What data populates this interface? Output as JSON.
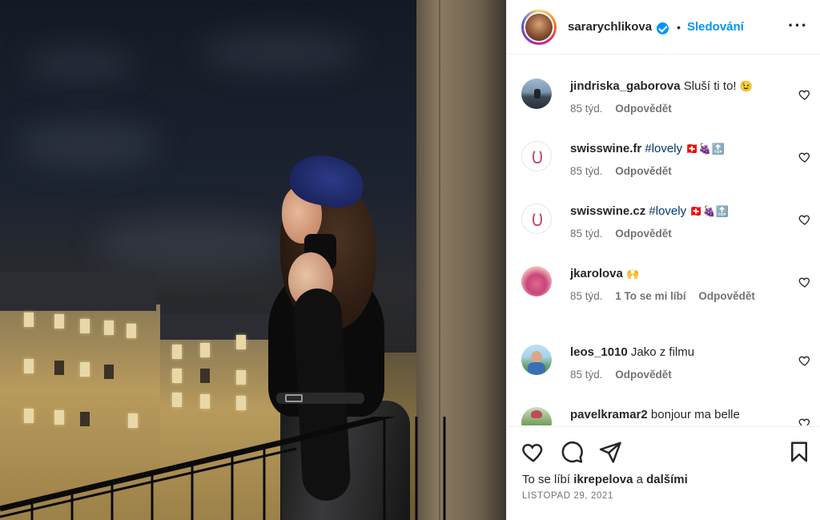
{
  "post": {
    "author": "sararychlikova",
    "follow_label": "Sledování",
    "dot": "•",
    "more": "•••"
  },
  "comments": [
    {
      "user": "jindriska_gaborova",
      "text": "Sluší ti to!",
      "emoji": "😉",
      "tag": "",
      "flags": "",
      "age": "85 týd.",
      "likes": "",
      "reply": "Odpovědět",
      "avatar": "landscape"
    },
    {
      "user": "swisswine.fr",
      "text": "",
      "emoji": "",
      "tag": "#lovely",
      "flags": "🇨🇭🍇🔝",
      "age": "85 týd.",
      "likes": "",
      "reply": "Odpovědět",
      "avatar": "swisswine"
    },
    {
      "user": "swisswine.cz",
      "text": "",
      "emoji": "",
      "tag": "#lovely",
      "flags": "🇨🇭🍇🔝",
      "age": "85 týd.",
      "likes": "",
      "reply": "Odpovědět",
      "avatar": "swisswine"
    },
    {
      "user": "jkarolova",
      "text": "",
      "emoji": "🙌",
      "tag": "",
      "flags": "",
      "age": "85 týd.",
      "likes": "1 To se mi líbí",
      "reply": "Odpovědět",
      "avatar": "pink"
    },
    {
      "user": "leos_1010",
      "text": "Jako z filmu",
      "emoji": "",
      "tag": "",
      "flags": "",
      "age": "85 týd.",
      "likes": "",
      "reply": "Odpovědět",
      "avatar": "man"
    },
    {
      "user": "pavelkramar2",
      "text": "bonjour ma belle",
      "emoji": "",
      "tag": "",
      "flags": "",
      "age": "",
      "likes": "",
      "reply": "",
      "avatar": "green"
    }
  ],
  "footer": {
    "likes_prefix": "To se líbí",
    "likes_user": "ikrepelova",
    "likes_conj": "a",
    "likes_others": "dalšími",
    "date": "LISTOPAD 29, 2021"
  },
  "icons": {
    "like": "heart-icon",
    "comment": "comment-bubble-icon",
    "share": "send-icon",
    "save": "bookmark-icon",
    "verified": "verified-badge-icon",
    "more": "more-options-icon"
  },
  "colors": {
    "accent": "#0095f6",
    "text": "#262626",
    "secondary": "#737373",
    "hashtag": "#00376b",
    "border": "#efefef"
  }
}
